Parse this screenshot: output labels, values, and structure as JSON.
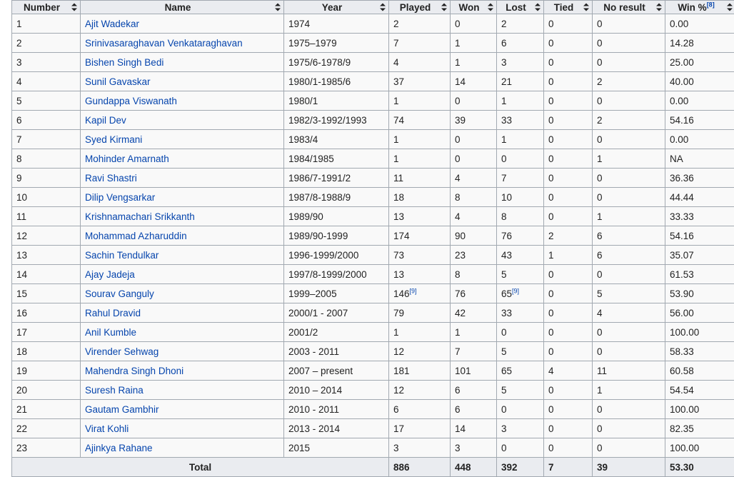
{
  "headers": [
    {
      "label": "Number",
      "sup": ""
    },
    {
      "label": "Name",
      "sup": ""
    },
    {
      "label": "Year",
      "sup": ""
    },
    {
      "label": "Played",
      "sup": ""
    },
    {
      "label": "Won",
      "sup": ""
    },
    {
      "label": "Lost",
      "sup": ""
    },
    {
      "label": "Tied",
      "sup": ""
    },
    {
      "label": "No result",
      "sup": ""
    },
    {
      "label": "Win %",
      "sup": "[8]"
    }
  ],
  "rows": [
    {
      "number": "1",
      "name": "Ajit Wadekar",
      "year": "1974",
      "played": "2",
      "played_ref": "",
      "won": "0",
      "lost": "2",
      "lost_ref": "",
      "tied": "0",
      "no_result": "0",
      "win_pct": "0.00"
    },
    {
      "number": "2",
      "name": "Srinivasaraghavan Venkataraghavan",
      "year": "1975–1979",
      "played": "7",
      "played_ref": "",
      "won": "1",
      "lost": "6",
      "lost_ref": "",
      "tied": "0",
      "no_result": "0",
      "win_pct": "14.28"
    },
    {
      "number": "3",
      "name": "Bishen Singh Bedi",
      "year": "1975/6-1978/9",
      "played": "4",
      "played_ref": "",
      "won": "1",
      "lost": "3",
      "lost_ref": "",
      "tied": "0",
      "no_result": "0",
      "win_pct": "25.00"
    },
    {
      "number": "4",
      "name": "Sunil Gavaskar",
      "year": "1980/1-1985/6",
      "played": "37",
      "played_ref": "",
      "won": "14",
      "lost": "21",
      "lost_ref": "",
      "tied": "0",
      "no_result": "2",
      "win_pct": "40.00"
    },
    {
      "number": "5",
      "name": "Gundappa Viswanath",
      "year": "1980/1",
      "played": "1",
      "played_ref": "",
      "won": "0",
      "lost": "1",
      "lost_ref": "",
      "tied": "0",
      "no_result": "0",
      "win_pct": "0.00"
    },
    {
      "number": "6",
      "name": "Kapil Dev",
      "year": "1982/3-1992/1993",
      "played": "74",
      "played_ref": "",
      "won": "39",
      "lost": "33",
      "lost_ref": "",
      "tied": "0",
      "no_result": "2",
      "win_pct": "54.16"
    },
    {
      "number": "7",
      "name": "Syed Kirmani",
      "year": "1983/4",
      "played": "1",
      "played_ref": "",
      "won": "0",
      "lost": "1",
      "lost_ref": "",
      "tied": "0",
      "no_result": "0",
      "win_pct": "0.00"
    },
    {
      "number": "8",
      "name": "Mohinder Amarnath",
      "year": "1984/1985",
      "played": "1",
      "played_ref": "",
      "won": "0",
      "lost": "0",
      "lost_ref": "",
      "tied": "0",
      "no_result": "1",
      "win_pct": "NA"
    },
    {
      "number": "9",
      "name": "Ravi Shastri",
      "year": "1986/7-1991/2",
      "played": "11",
      "played_ref": "",
      "won": "4",
      "lost": "7",
      "lost_ref": "",
      "tied": "0",
      "no_result": "0",
      "win_pct": "36.36"
    },
    {
      "number": "10",
      "name": "Dilip Vengsarkar",
      "year": "1987/8-1988/9",
      "played": "18",
      "played_ref": "",
      "won": "8",
      "lost": "10",
      "lost_ref": "",
      "tied": "0",
      "no_result": "0",
      "win_pct": "44.44"
    },
    {
      "number": "11",
      "name": "Krishnamachari Srikkanth",
      "year": "1989/90",
      "played": "13",
      "played_ref": "",
      "won": "4",
      "lost": "8",
      "lost_ref": "",
      "tied": "0",
      "no_result": "1",
      "win_pct": "33.33"
    },
    {
      "number": "12",
      "name": "Mohammad Azharuddin",
      "year": "1989/90-1999",
      "played": "174",
      "played_ref": "",
      "won": "90",
      "lost": "76",
      "lost_ref": "",
      "tied": "2",
      "no_result": "6",
      "win_pct": "54.16"
    },
    {
      "number": "13",
      "name": "Sachin Tendulkar",
      "year": "1996-1999/2000",
      "played": "73",
      "played_ref": "",
      "won": "23",
      "lost": "43",
      "lost_ref": "",
      "tied": "1",
      "no_result": "6",
      "win_pct": "35.07"
    },
    {
      "number": "14",
      "name": "Ajay Jadeja",
      "year": "1997/8-1999/2000",
      "played": "13",
      "played_ref": "",
      "won": "8",
      "lost": "5",
      "lost_ref": "",
      "tied": "0",
      "no_result": "0",
      "win_pct": "61.53"
    },
    {
      "number": "15",
      "name": "Sourav Ganguly",
      "year": "1999–2005",
      "played": "146",
      "played_ref": "[9]",
      "won": "76",
      "lost": "65",
      "lost_ref": "[9]",
      "tied": "0",
      "no_result": "5",
      "win_pct": "53.90"
    },
    {
      "number": "16",
      "name": "Rahul Dravid",
      "year": "2000/1 - 2007",
      "played": "79",
      "played_ref": "",
      "won": "42",
      "lost": "33",
      "lost_ref": "",
      "tied": "0",
      "no_result": "4",
      "win_pct": "56.00"
    },
    {
      "number": "17",
      "name": "Anil Kumble",
      "year": "2001/2",
      "played": "1",
      "played_ref": "",
      "won": "1",
      "lost": "0",
      "lost_ref": "",
      "tied": "0",
      "no_result": "0",
      "win_pct": "100.00"
    },
    {
      "number": "18",
      "name": "Virender Sehwag",
      "year": "2003 - 2011",
      "played": "12",
      "played_ref": "",
      "won": "7",
      "lost": "5",
      "lost_ref": "",
      "tied": "0",
      "no_result": "0",
      "win_pct": "58.33"
    },
    {
      "number": "19",
      "name": "Mahendra Singh Dhoni",
      "year": "2007 – present",
      "played": "181",
      "played_ref": "",
      "won": "101",
      "lost": "65",
      "lost_ref": "",
      "tied": "4",
      "no_result": "11",
      "win_pct": "60.58"
    },
    {
      "number": "20",
      "name": "Suresh Raina",
      "year": "2010 – 2014",
      "played": "12",
      "played_ref": "",
      "won": "6",
      "lost": "5",
      "lost_ref": "",
      "tied": "0",
      "no_result": "1",
      "win_pct": "54.54"
    },
    {
      "number": "21",
      "name": "Gautam Gambhir",
      "year": "2010 - 2011",
      "played": "6",
      "played_ref": "",
      "won": "6",
      "lost": "0",
      "lost_ref": "",
      "tied": "0",
      "no_result": "0",
      "win_pct": "100.00"
    },
    {
      "number": "22",
      "name": "Virat Kohli",
      "year": "2013 - 2014",
      "played": "17",
      "played_ref": "",
      "won": "14",
      "lost": "3",
      "lost_ref": "",
      "tied": "0",
      "no_result": "0",
      "win_pct": "82.35"
    },
    {
      "number": "23",
      "name": "Ajinkya Rahane",
      "year": "2015",
      "played": "3",
      "played_ref": "",
      "won": "3",
      "lost": "0",
      "lost_ref": "",
      "tied": "0",
      "no_result": "0",
      "win_pct": "100.00"
    }
  ],
  "total": {
    "label": "Total",
    "played": "886",
    "won": "448",
    "lost": "392",
    "tied": "7",
    "no_result": "39",
    "win_pct": "53.30"
  },
  "colors": {
    "link": "#0645ad",
    "header_bg": "#eaecf0",
    "cell_bg": "#f9f9f9",
    "border": "#a2a9b1"
  },
  "icons": {
    "sort": "sort-both-arrows-icon"
  }
}
